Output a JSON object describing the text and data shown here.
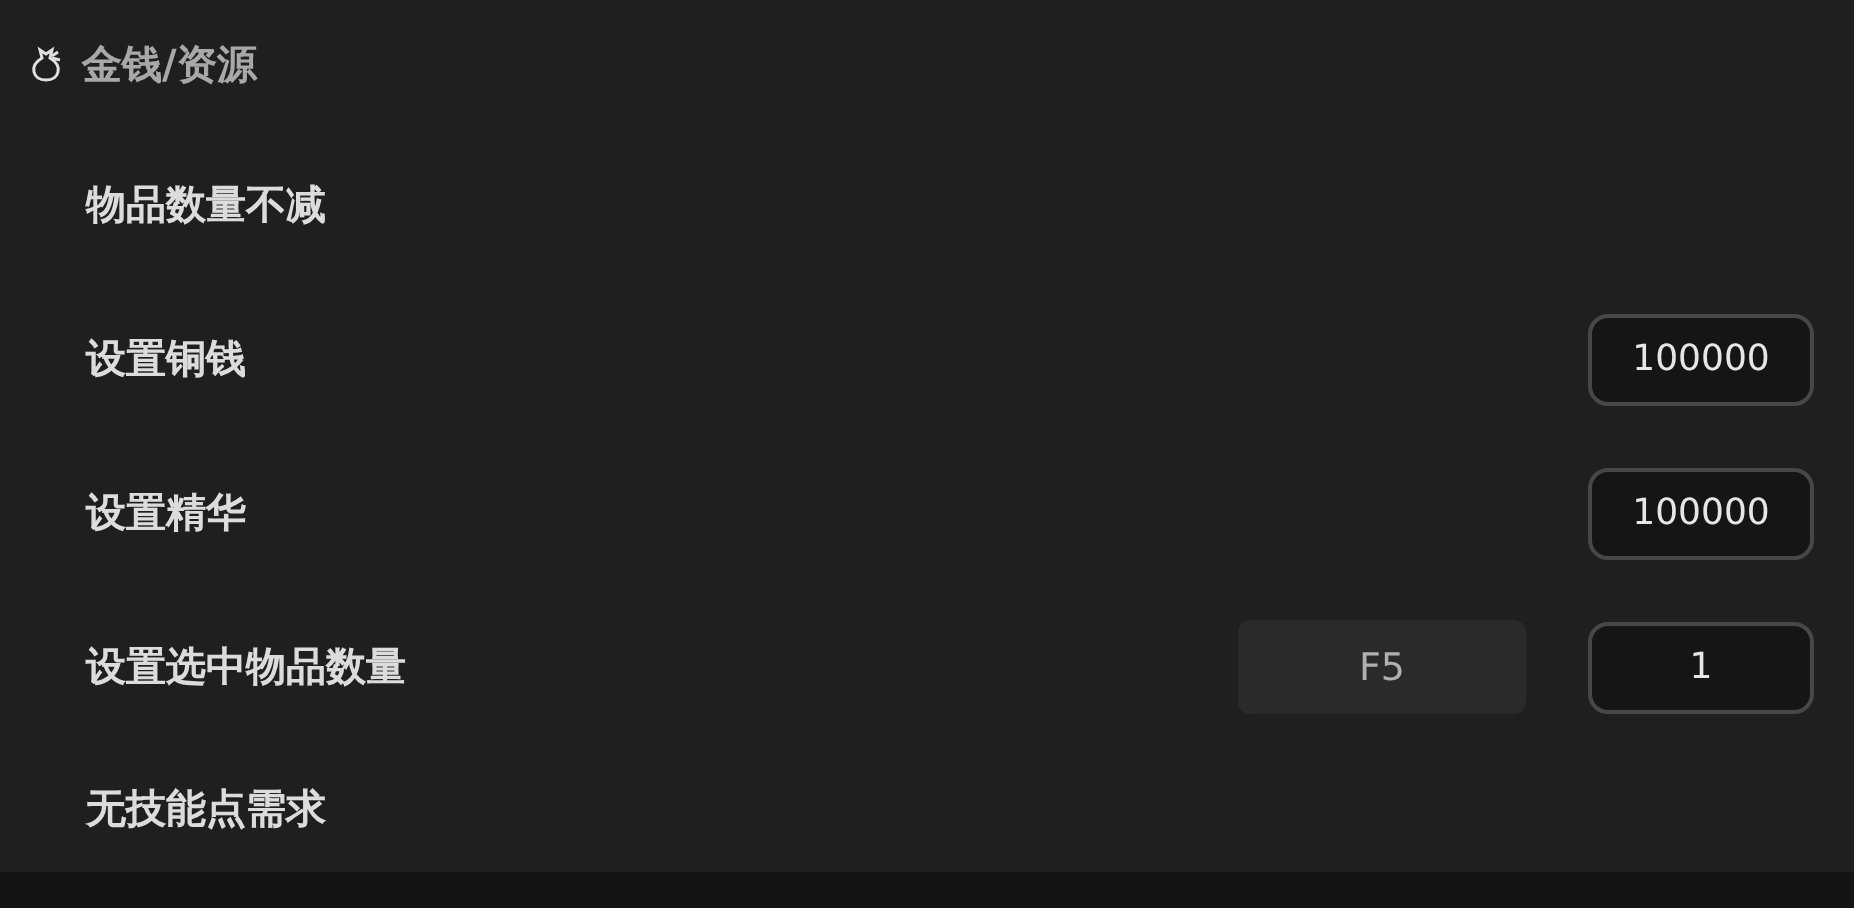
{
  "section": {
    "title": "金钱/资源"
  },
  "rows": [
    {
      "kind": "plain",
      "label": "物品数量不减"
    },
    {
      "kind": "input",
      "label": "设置铜钱",
      "value": "100000"
    },
    {
      "kind": "input",
      "label": "设置精华",
      "value": "100000"
    },
    {
      "kind": "hotkey_input",
      "label": "设置选中物品数量",
      "hotkey": "F5",
      "value": "1"
    },
    {
      "kind": "plain",
      "label": "无技能点需求"
    }
  ]
}
